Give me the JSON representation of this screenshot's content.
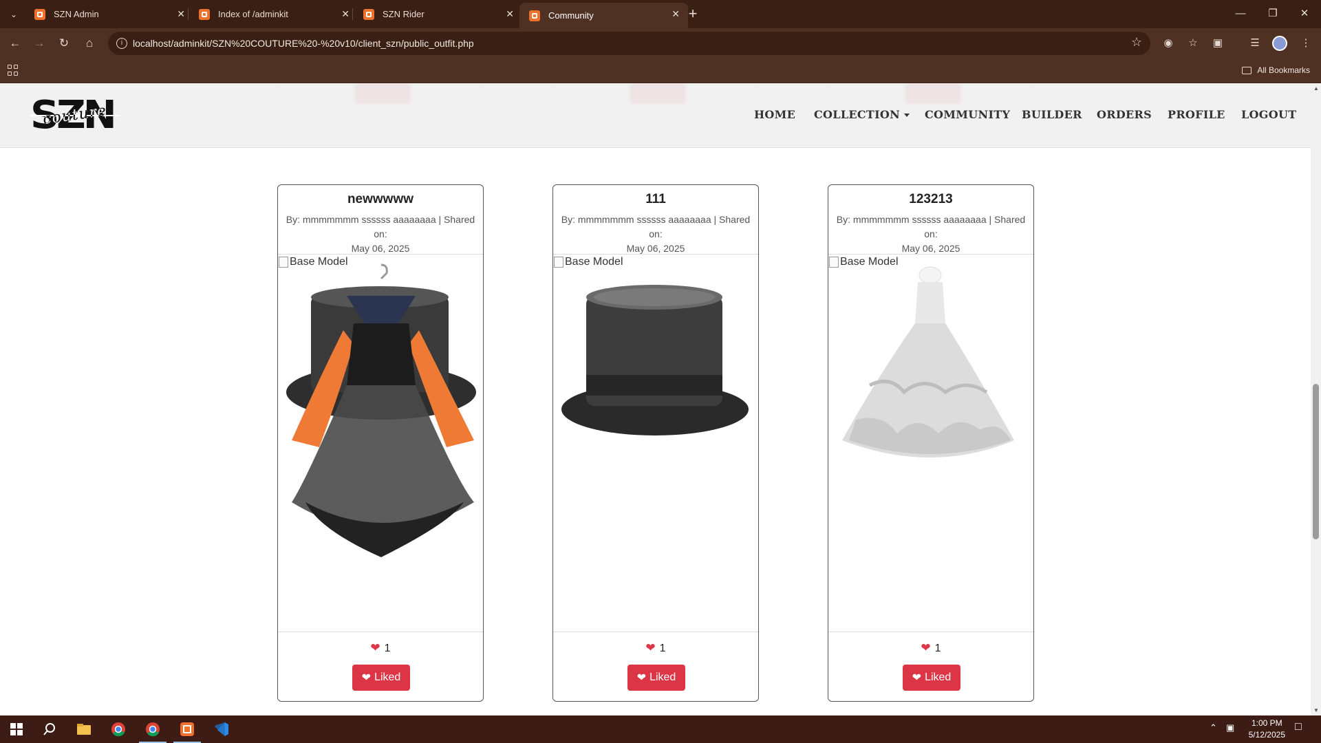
{
  "browser": {
    "tabs": [
      {
        "title": "SZN Admin"
      },
      {
        "title": "Index of /adminkit"
      },
      {
        "title": "SZN Rider"
      },
      {
        "title": "Community"
      }
    ],
    "url": "localhost/adminkit/SZN%20COUTURE%20-%20v10/client_szn/public_outfit.php",
    "all_bookmarks": "All Bookmarks"
  },
  "site": {
    "logo_text": "SZN",
    "logo_script": "couture",
    "nav": {
      "home": "HOME",
      "collection": "COLLECTION",
      "community": "COMMUNITY",
      "builder": "BUILDER",
      "orders": "ORDERS",
      "profile": "PROFILE",
      "logout": "LOGOUT"
    }
  },
  "outfits": [
    {
      "title": "newwwww",
      "meta_line1": "By: mmmmmmm ssssss aaaaaaaa | Shared on:",
      "meta_line2": "May 06, 2025",
      "image_alt": "Base Model",
      "likes": "1",
      "button_label": "Liked"
    },
    {
      "title": "111",
      "meta_line1": "By: mmmmmmm ssssss aaaaaaaa | Shared on:",
      "meta_line2": "May 06, 2025",
      "image_alt": "Base Model",
      "likes": "1",
      "button_label": "Liked"
    },
    {
      "title": "123213",
      "meta_line1": "By: mmmmmmm ssssss aaaaaaaa | Shared on:",
      "meta_line2": "May 06, 2025",
      "image_alt": "Base Model",
      "likes": "1",
      "button_label": "Liked"
    }
  ],
  "ghost_button_label": "Liked",
  "taskbar": {
    "time": "1:00 PM",
    "date": "5/12/2025"
  },
  "colors": {
    "accent_red": "#dc3545",
    "chrome_brown": "#4f3124",
    "taskbar_brown": "#3c1c14"
  }
}
